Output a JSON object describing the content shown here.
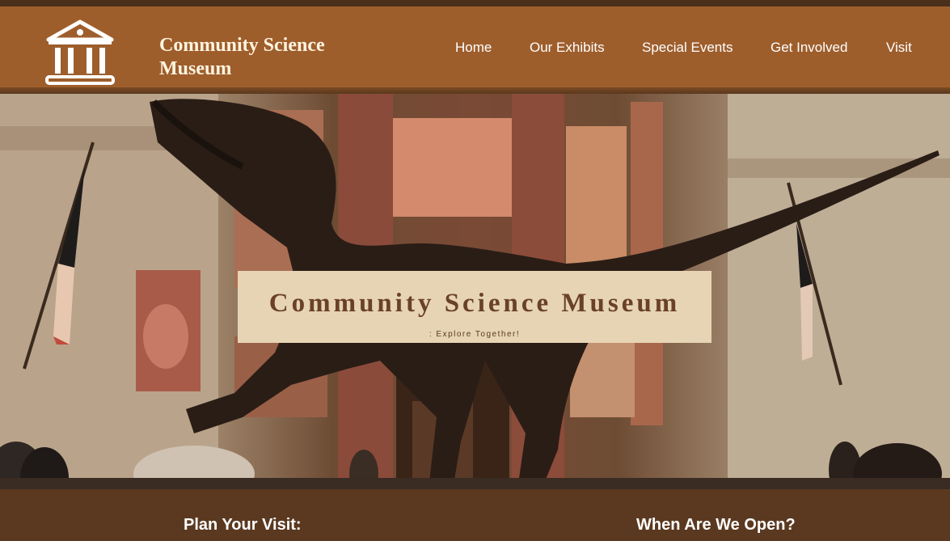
{
  "header": {
    "brand_line1": "Community Science",
    "brand_line2": "Museum",
    "logo_icon": "museum-building-icon"
  },
  "nav": {
    "items": [
      {
        "label": "Home"
      },
      {
        "label": "Our Exhibits"
      },
      {
        "label": "Special Events"
      },
      {
        "label": "Get Involved"
      },
      {
        "label": "Visit"
      }
    ]
  },
  "hero": {
    "title": "Community Science Museum",
    "tagline": ": Explore Together!"
  },
  "sections": {
    "plan_heading": "Plan Your Visit:",
    "hours_heading": "When Are We Open?"
  },
  "colors": {
    "header_bg": "#9e5e2c",
    "page_bg": "#5a3920",
    "banner_bg": "#e6d4b4",
    "title_text": "#6a4128"
  }
}
